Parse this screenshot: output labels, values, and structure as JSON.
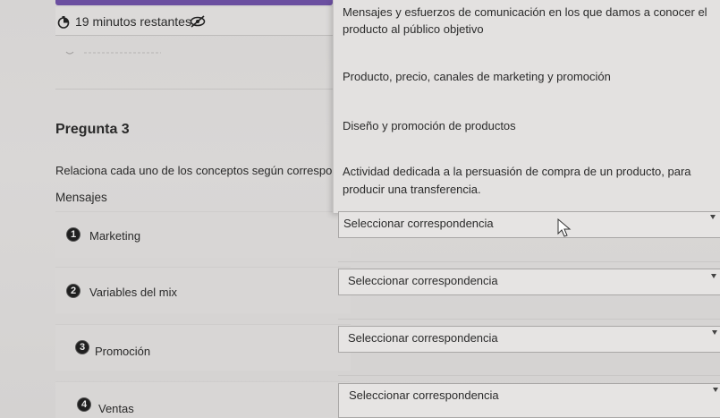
{
  "header": {
    "timer_text": "19 minutos restantes",
    "timer_icon": "timer-icon",
    "visibility_icon": "eye-slash-icon",
    "accent_color": "#6b4fa0"
  },
  "question": {
    "title": "Pregunta 3",
    "instruction": "Relaciona cada uno de los conceptos según correspon",
    "column_label": "Mensajes",
    "items": [
      {
        "number": "1",
        "label": "Marketing"
      },
      {
        "number": "2",
        "label": "Variables del mix"
      },
      {
        "number": "3",
        "label": "Promoción"
      },
      {
        "number": "4",
        "label": "Ventas"
      }
    ]
  },
  "dropdown": {
    "options": [
      "Mensajes y esfuerzos de comunicación en los que damos a conocer el",
      "producto al público objetivo",
      "Producto, precio, canales de marketing y promoción",
      "Diseño y promoción de productos",
      "Actividad dedicada a la persuasión de compra de un producto, para",
      "producir una transferencia."
    ]
  },
  "selects": [
    {
      "value": "Seleccionar correspondencia"
    },
    {
      "value": "Seleccionar correspondencia"
    },
    {
      "value": "Seleccionar correspondencia"
    },
    {
      "value": "Seleccionar correspondencia"
    }
  ]
}
